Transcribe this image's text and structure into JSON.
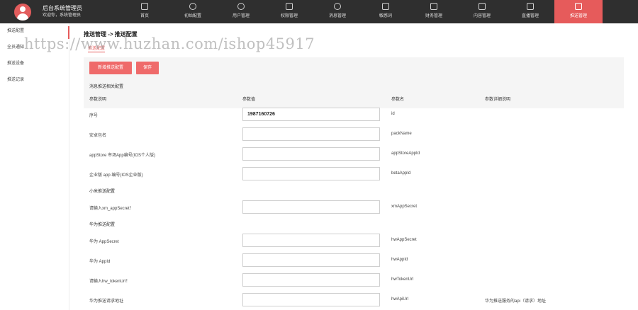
{
  "header": {
    "title": "后台系统管理员",
    "subtitle": "欢迎你，系统管理员",
    "nav": [
      {
        "label": "首页",
        "icon": "home-icon"
      },
      {
        "label": "初始配置",
        "icon": "gear-icon"
      },
      {
        "label": "用户管理",
        "icon": "user-icon"
      },
      {
        "label": "权限管理",
        "icon": "lock-icon"
      },
      {
        "label": "消息管理",
        "icon": "message-icon"
      },
      {
        "label": "敏感词",
        "icon": "filter-icon"
      },
      {
        "label": "财务管理",
        "icon": "wallet-icon"
      },
      {
        "label": "内容管理",
        "icon": "document-icon"
      },
      {
        "label": "直播管理",
        "icon": "live-icon"
      },
      {
        "label": "推送管理",
        "icon": "push-icon"
      }
    ],
    "active_nav": "推送管理"
  },
  "sidebar": {
    "items": [
      "推送配置",
      "全员通知",
      "推送设备",
      "推送记录"
    ]
  },
  "main": {
    "breadcrumb": "推送管理 -> 推送配置",
    "subtab": "推送配置",
    "buttons": {
      "add": "新增推送配置",
      "save": "保存"
    },
    "section_title": "消息推送相关配置",
    "columns": [
      "参数说明",
      "参数值",
      "参数名",
      "参数详细说明"
    ],
    "rows": [
      {
        "label": "序号",
        "value": "1987160726",
        "param": "id",
        "note": ""
      },
      {
        "label": "安卓包名",
        "value": "",
        "param": "packName",
        "note": ""
      },
      {
        "label": "appStore 市场App编号(IOS个人版)",
        "value": "",
        "param": "appStoreAppId",
        "note": ""
      },
      {
        "label": "企业版 app 编号(IOS企业版)",
        "value": "",
        "param": "betaAppId",
        "note": ""
      },
      {
        "label": "请输入xm_appSecret！",
        "value": "",
        "param": "xmAppSecret",
        "note": ""
      },
      {
        "label": "华为 AppSecret",
        "value": "",
        "param": "hwAppSecret",
        "note": ""
      },
      {
        "label": "华为 AppId",
        "value": "",
        "param": "hwAppId",
        "note": ""
      },
      {
        "label": "请输入hw_tokenUrl！",
        "value": "",
        "param": "hwTokenUrl",
        "note": ""
      },
      {
        "label": "华为推送请求地址",
        "value": "",
        "param": "hwApiUrl",
        "note": "华为推送服务的api（请求）地址"
      }
    ],
    "groups": {
      "xiaomi": "小米推送配置",
      "huawei": "华为推送配置"
    }
  },
  "watermark": "https://www.huzhan.com/ishop45917",
  "colors": {
    "accent": "#e65b5b",
    "header_bg": "#2f2f2f",
    "panel_bg": "#f5f5f5"
  }
}
